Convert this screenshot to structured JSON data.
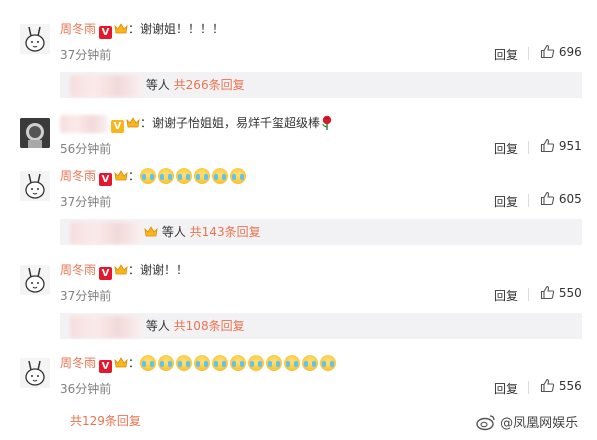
{
  "comments": [
    {
      "name": "周冬雨",
      "text": "：谢谢姐！！！！",
      "time": "37分钟前",
      "reply": "回复",
      "likes": "696",
      "sub_text": "等人",
      "sub_link": "共266条回复"
    },
    {
      "text": "：谢谢子怡姐姐，易烊千玺超级棒",
      "time": "56分钟前",
      "reply": "回复",
      "likes": "951"
    },
    {
      "name": "周冬雨",
      "text": "：",
      "emoji_count": 6,
      "time": "37分钟前",
      "reply": "回复",
      "likes": "605",
      "sub_text": "等人",
      "sub_link": "共143条回复"
    },
    {
      "name": "周冬雨",
      "text": "：谢谢！！",
      "time": "37分钟前",
      "reply": "回复",
      "likes": "550",
      "sub_text": "等人",
      "sub_link": "共108条回复"
    },
    {
      "name": "周冬雨",
      "text": "：",
      "emoji_count": 11,
      "time": "36分钟前",
      "reply": "回复",
      "likes": "556",
      "sub_link": "共129条回复"
    }
  ],
  "watermark": {
    "text": "@凤凰网娱乐"
  },
  "colors": {
    "accent": "#eb7350",
    "vip": "#e6162d",
    "subbox": "#f2f2f5"
  },
  "icons": {
    "like": "thumbs-up-icon",
    "vip": "v-badge-icon",
    "crown": "crown-icon",
    "rose": "rose-icon",
    "weibo": "weibo-logo-icon"
  }
}
